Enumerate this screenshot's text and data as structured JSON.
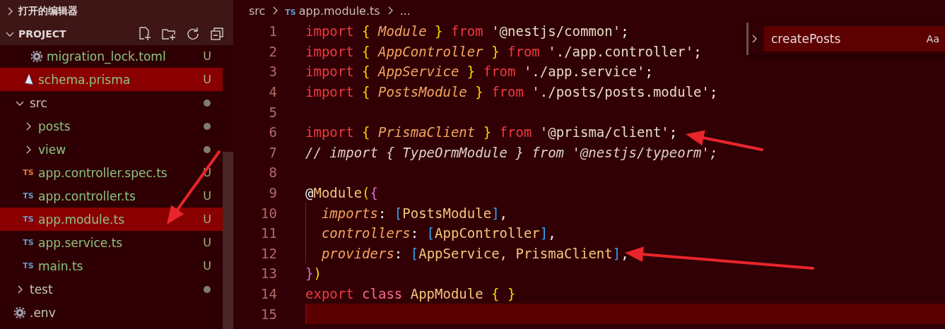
{
  "sidebar": {
    "sections": [
      {
        "title": "打开的编辑器",
        "expanded": false
      },
      {
        "title": "PROJECT",
        "expanded": true
      }
    ],
    "tree": [
      {
        "children": [
          {
            "children": [
              {
                "label": "migration_lock.toml",
                "kind": "gear",
                "badge": "U",
                "untracked": true,
                "selected": false
              }
            ]
          },
          {
            "label": "schema.prisma",
            "kind": "prisma",
            "badge": "U",
            "untracked": true,
            "selected": true
          }
        ]
      },
      {
        "label": "src",
        "kind": "folder",
        "expanded": true,
        "dot": true,
        "untracked": false,
        "selected": false,
        "children": [
          {
            "label": "posts",
            "kind": "folder",
            "expanded": false,
            "dot": true,
            "untracked": true,
            "selected": false
          },
          {
            "label": "view",
            "kind": "folder",
            "expanded": false,
            "dot": true,
            "untracked": true,
            "selected": false
          },
          {
            "label": "app.controller.spec.ts",
            "kind": "spec",
            "icon_text": "TS",
            "badge": "U",
            "untracked": true,
            "selected": false
          },
          {
            "label": "app.controller.ts",
            "kind": "script",
            "icon_text": "TS",
            "badge": "U",
            "untracked": true,
            "selected": false
          },
          {
            "label": "app.module.ts",
            "kind": "script",
            "icon_text": "TS",
            "badge": "U",
            "untracked": true,
            "selected": true
          },
          {
            "label": "app.service.ts",
            "kind": "script",
            "icon_text": "TS",
            "badge": "U",
            "untracked": true,
            "selected": false
          },
          {
            "label": "main.ts",
            "kind": "script",
            "icon_text": "TS",
            "badge": "U",
            "untracked": true,
            "selected": false
          }
        ]
      },
      {
        "label": "test",
        "kind": "folder",
        "expanded": false,
        "dot": true,
        "untracked": false,
        "selected": false
      },
      {
        "label": ".env",
        "kind": "gear",
        "untracked": false,
        "selected": false
      }
    ]
  },
  "breadcrumb": [
    {
      "text": "src"
    },
    {
      "text": "app.module.ts",
      "icon_text": "TS"
    },
    {
      "text": "..."
    }
  ],
  "code": [
    {
      "number": "1",
      "tokens": [
        {
          "text": "import ",
          "kind": "kw"
        },
        {
          "text": "{ ",
          "kind": "brace"
        },
        {
          "text": "Module",
          "kind": "type"
        },
        {
          "text": " } ",
          "kind": "brace"
        },
        {
          "text": "from ",
          "kind": "kw"
        },
        {
          "text": "'@nestjs/common'",
          "kind": "str"
        },
        {
          "text": ";",
          "kind": "punct"
        }
      ]
    },
    {
      "number": "2",
      "tokens": [
        {
          "text": "import ",
          "kind": "kw"
        },
        {
          "text": "{ ",
          "kind": "brace"
        },
        {
          "text": "AppController",
          "kind": "type"
        },
        {
          "text": " } ",
          "kind": "brace"
        },
        {
          "text": "from ",
          "kind": "kw"
        },
        {
          "text": "'./app.controller'",
          "kind": "str"
        },
        {
          "text": ";",
          "kind": "punct"
        }
      ]
    },
    {
      "number": "3",
      "tokens": [
        {
          "text": "import ",
          "kind": "kw"
        },
        {
          "text": "{ ",
          "kind": "brace"
        },
        {
          "text": "AppService",
          "kind": "type"
        },
        {
          "text": " } ",
          "kind": "brace"
        },
        {
          "text": "from ",
          "kind": "kw"
        },
        {
          "text": "'./app.service'",
          "kind": "str"
        },
        {
          "text": ";",
          "kind": "punct"
        }
      ]
    },
    {
      "number": "4",
      "tokens": [
        {
          "text": "import ",
          "kind": "kw"
        },
        {
          "text": "{ ",
          "kind": "brace"
        },
        {
          "text": "PostsModule",
          "kind": "type"
        },
        {
          "text": " } ",
          "kind": "brace"
        },
        {
          "text": "from ",
          "kind": "kw"
        },
        {
          "text": "'./posts/posts.module'",
          "kind": "str"
        },
        {
          "text": ";",
          "kind": "punct"
        }
      ]
    },
    {
      "number": "5"
    },
    {
      "number": "6",
      "tokens": [
        {
          "text": "import ",
          "kind": "kw"
        },
        {
          "text": "{ ",
          "kind": "brace"
        },
        {
          "text": "PrismaClient",
          "kind": "type"
        },
        {
          "text": " } ",
          "kind": "brace"
        },
        {
          "text": "from ",
          "kind": "kw"
        },
        {
          "text": "'@prisma/client'",
          "kind": "str"
        },
        {
          "text": ";",
          "kind": "punct"
        }
      ]
    },
    {
      "number": "7",
      "tokens": [
        {
          "text": "// import { TypeOrmModule } from '@nestjs/typeorm';",
          "kind": "comment"
        }
      ]
    },
    {
      "number": "8"
    },
    {
      "number": "9",
      "tokens": [
        {
          "text": "@",
          "kind": "punct"
        },
        {
          "text": "Module",
          "kind": "cls"
        },
        {
          "text": "(",
          "kind": "brace"
        },
        {
          "text": "{",
          "kind": "br2"
        }
      ]
    },
    {
      "number": "10",
      "guide": true,
      "tokens": [
        {
          "text": "  imports",
          "kind": "prop"
        },
        {
          "text": ": ",
          "kind": "punct"
        },
        {
          "text": "[",
          "kind": "br3"
        },
        {
          "text": "PostsModule",
          "kind": "cls"
        },
        {
          "text": "]",
          "kind": "br3"
        },
        {
          "text": ",",
          "kind": "punct"
        }
      ]
    },
    {
      "number": "11",
      "guide": true,
      "tokens": [
        {
          "text": "  controllers",
          "kind": "prop"
        },
        {
          "text": ": ",
          "kind": "punct"
        },
        {
          "text": "[",
          "kind": "br3"
        },
        {
          "text": "AppController",
          "kind": "cls"
        },
        {
          "text": "]",
          "kind": "br3"
        },
        {
          "text": ",",
          "kind": "punct"
        }
      ]
    },
    {
      "number": "12",
      "guide": true,
      "tokens": [
        {
          "text": "  providers",
          "kind": "prop"
        },
        {
          "text": ": ",
          "kind": "punct"
        },
        {
          "text": "[",
          "kind": "br3"
        },
        {
          "text": "AppService, PrismaClient",
          "kind": "cls"
        },
        {
          "text": "]",
          "kind": "br3"
        },
        {
          "text": ",",
          "kind": "punct"
        }
      ]
    },
    {
      "number": "13",
      "tokens": [
        {
          "text": "}",
          "kind": "br2"
        },
        {
          "text": ")",
          "kind": "brace"
        }
      ]
    },
    {
      "number": "14",
      "tokens": [
        {
          "text": "export ",
          "kind": "kw"
        },
        {
          "text": "class ",
          "kind": "kw2"
        },
        {
          "text": "AppModule ",
          "kind": "cls"
        },
        {
          "text": "{ }",
          "kind": "brace"
        }
      ]
    },
    {
      "number": "15",
      "current": true
    }
  ],
  "find": {
    "value": "createPosts",
    "options": [
      {
        "text": "Aa"
      }
    ]
  }
}
